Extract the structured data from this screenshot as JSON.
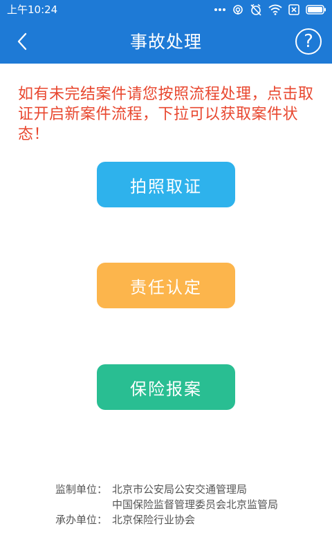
{
  "status_bar": {
    "time": "上午10:24",
    "icons": [
      "signal-dots-icon",
      "hotspot-icon",
      "alarm-off-icon",
      "wifi-icon",
      "sim-card-icon",
      "battery-icon"
    ]
  },
  "header": {
    "back_icon": "chevron-left-icon",
    "title": "事故处理",
    "help_label": "?"
  },
  "notice": "如有未完结案件请您按照流程处理，点击取证开启新案件流程，下拉可以获取案件状态！",
  "actions": [
    {
      "label": "拍照取证",
      "color": "#2eb2ec"
    },
    {
      "label": "责任认定",
      "color": "#fcb54c"
    },
    {
      "label": "保险报案",
      "color": "#29be92"
    }
  ],
  "footer": {
    "supervisor_label": "监制单位：",
    "supervisor_1": "北京市公安局公安交通管理局",
    "supervisor_2": "中国保险监督管理委员会北京监管局",
    "organizer_label": "承办单位：",
    "organizer": "北京保险行业协会"
  },
  "colors": {
    "brand": "#1e7ad6",
    "notice": "#e8472f"
  }
}
